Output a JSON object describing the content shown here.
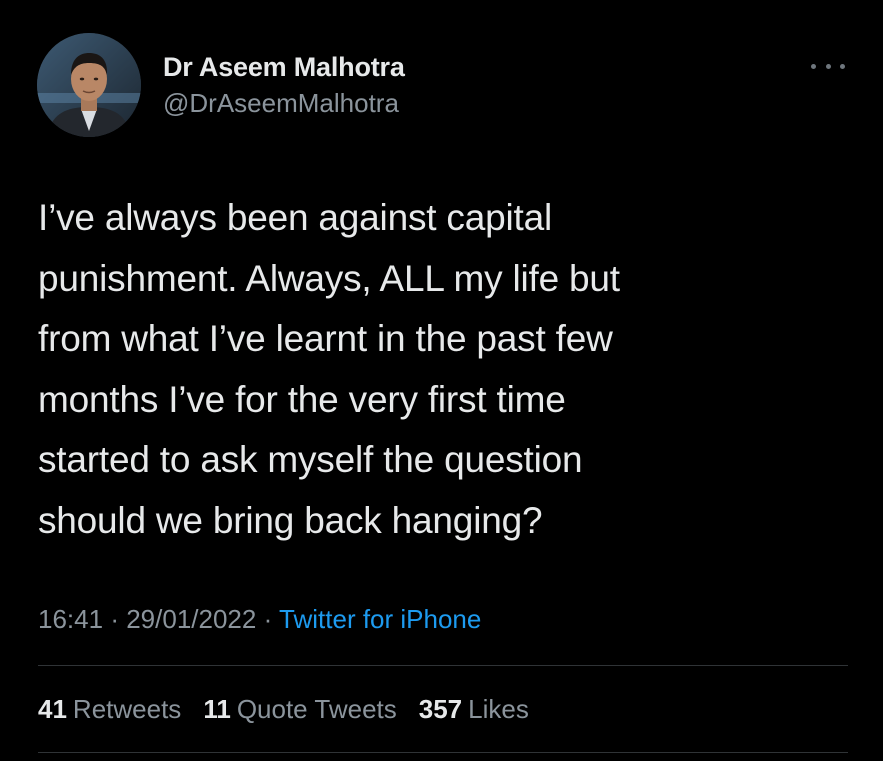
{
  "tweet": {
    "author": {
      "name": "Dr Aseem Malhotra",
      "handle": "@DrAseemMalhotra"
    },
    "text": "I’ve always been against capital\npunishment. Always, ALL my life but\nfrom what I’ve learnt in the past few\nmonths I’ve for the very first time\nstarted to ask myself the question\nshould we bring back hanging?",
    "time": "16:41",
    "separator": "·",
    "date": "29/01/2022",
    "source": "Twitter for iPhone",
    "stats": {
      "retweets_count": "41",
      "retweets_label": "Retweets",
      "quotes_count": "11",
      "quotes_label": "Quote Tweets",
      "likes_count": "357",
      "likes_label": "Likes"
    }
  },
  "colors": {
    "background": "#000000",
    "text": "#e7e9ea",
    "secondary_text": "#8b949c",
    "link": "#1d9bf0",
    "divider": "#2f3336"
  },
  "icons": {
    "more": "more-horizontal-icon"
  }
}
